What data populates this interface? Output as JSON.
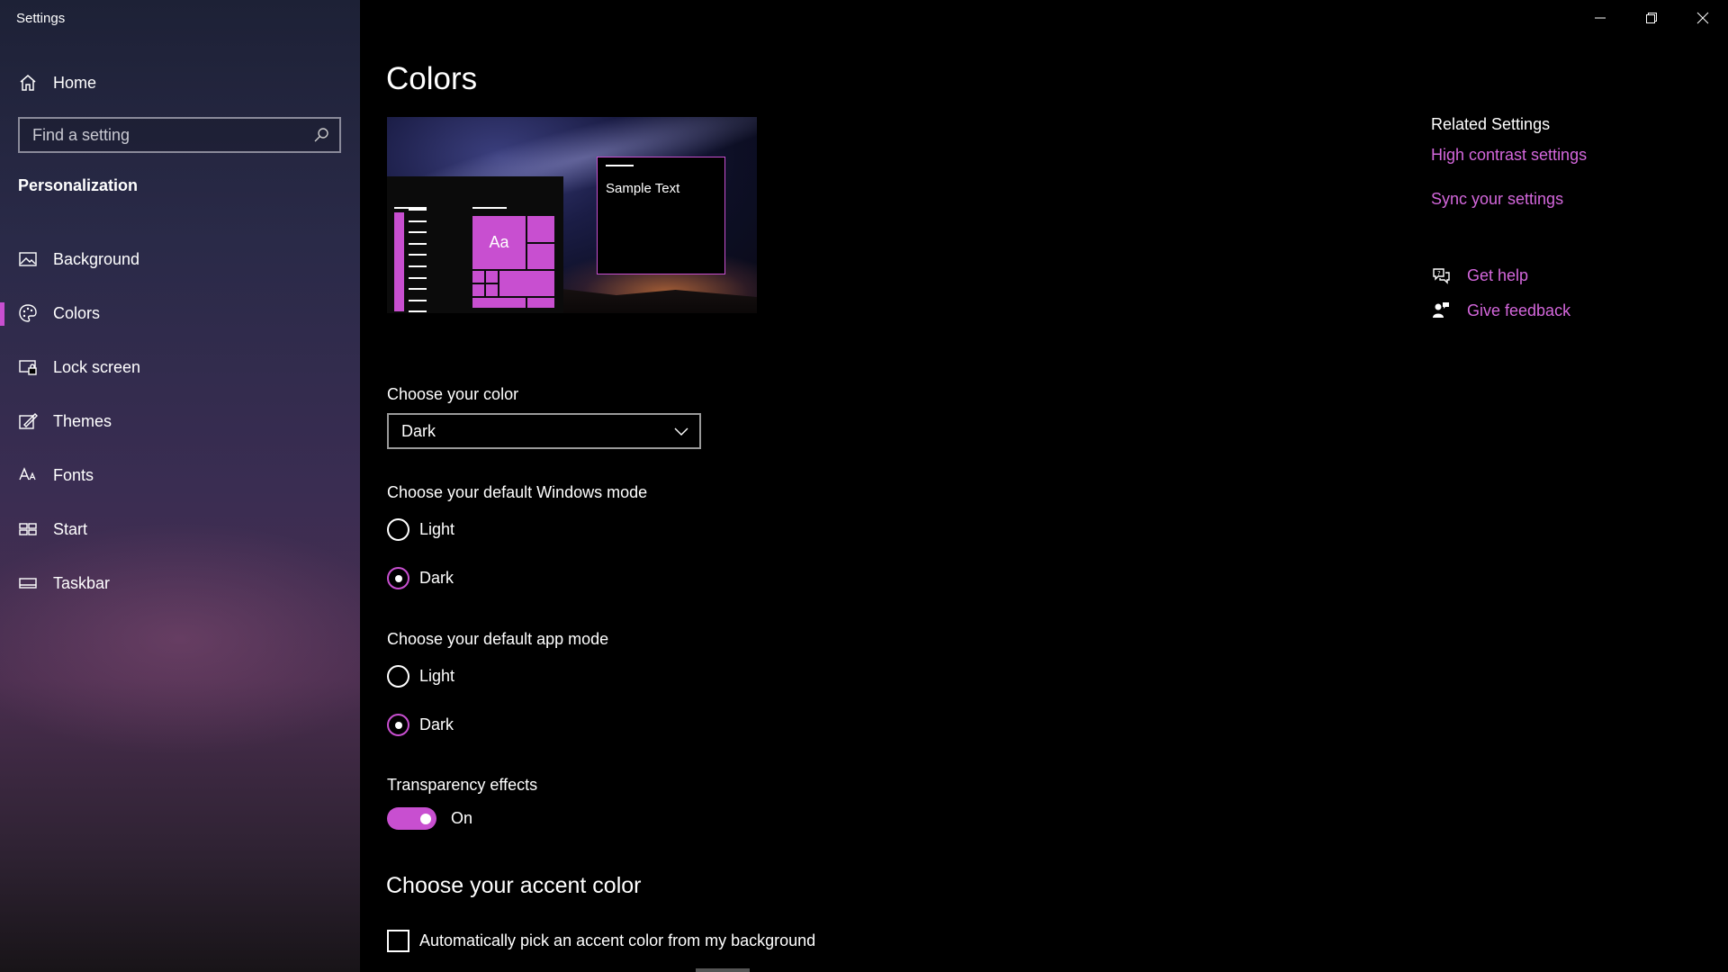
{
  "window": {
    "title": "Settings"
  },
  "sidebar": {
    "home_label": "Home",
    "search_placeholder": "Find a setting",
    "section_title": "Personalization",
    "items": [
      {
        "label": "Background",
        "icon": "picture-icon"
      },
      {
        "label": "Colors",
        "icon": "palette-icon",
        "selected": true
      },
      {
        "label": "Lock screen",
        "icon": "lock-screen-icon"
      },
      {
        "label": "Themes",
        "icon": "themes-brush-icon"
      },
      {
        "label": "Fonts",
        "icon": "fonts-icon"
      },
      {
        "label": "Start",
        "icon": "start-icon"
      },
      {
        "label": "Taskbar",
        "icon": "taskbar-icon"
      }
    ]
  },
  "main": {
    "title": "Colors",
    "preview": {
      "tile_text": "Aa",
      "sample_text": "Sample Text"
    },
    "choose_color": {
      "label": "Choose your color",
      "selected": "Dark"
    },
    "windows_mode": {
      "label": "Choose your default Windows mode",
      "options": [
        "Light",
        "Dark"
      ],
      "selected": "Dark"
    },
    "app_mode": {
      "label": "Choose your default app mode",
      "options": [
        "Light",
        "Dark"
      ],
      "selected": "Dark"
    },
    "transparency": {
      "label": "Transparency effects",
      "state": "On"
    },
    "accent": {
      "heading": "Choose your accent color",
      "auto_pick_label": "Automatically pick an accent color from my background",
      "auto_pick_checked": false
    }
  },
  "related": {
    "heading": "Related Settings",
    "links": [
      "High contrast settings",
      "Sync your settings"
    ],
    "help": "Get help",
    "feedback": "Give feedback"
  },
  "colors": {
    "accent": "#c84fd0",
    "link": "#d467dc",
    "background": "#000000"
  }
}
